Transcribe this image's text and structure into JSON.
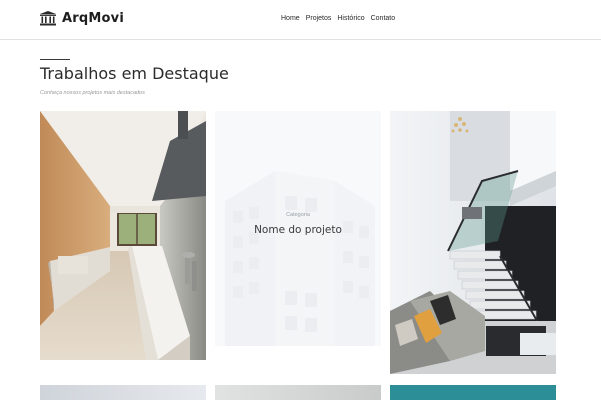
{
  "brand": {
    "name": "ArqMovi",
    "icon": "building-columns-icon"
  },
  "nav": [
    {
      "label": "Home"
    },
    {
      "label": "Projetos"
    },
    {
      "label": "Histórico"
    },
    {
      "label": "Contato"
    }
  ],
  "section": {
    "title": "Trabalhos em Destaque",
    "subtitle": "Conheça nossos projetos mais destacados"
  },
  "cards": [
    {
      "image": "kitchen-interior-photo"
    },
    {
      "image": "building-facade-photo",
      "category": "Categoria",
      "name": "Nome do projeto"
    },
    {
      "image": "staircase-living-room-photo"
    }
  ],
  "colors": {
    "text": "#2b2b2b",
    "border": "#e1e1e1",
    "muted": "#9a9a9a",
    "teal": "#2c8f97"
  }
}
